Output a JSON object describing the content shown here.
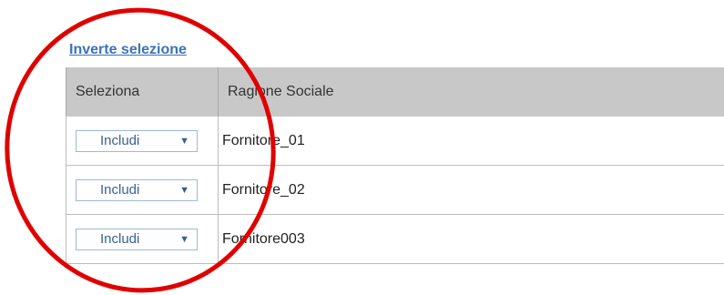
{
  "invert_link": "Inverte selezione",
  "table": {
    "headers": [
      "Seleziona",
      "Ragione Sociale"
    ],
    "rows": [
      {
        "select_value": "Includi",
        "name": "Fornitore_01"
      },
      {
        "select_value": "Includi",
        "name": "Fornitore_02"
      },
      {
        "select_value": "Includi",
        "name": "Fornitore003"
      }
    ]
  },
  "icons": {
    "dropdown_arrow": "chevron-down-icon"
  },
  "colors": {
    "link": "#3b73b9",
    "header_bg": "#c8c8c8",
    "select_border": "#9fb7d6",
    "annotation": "#e00000"
  }
}
